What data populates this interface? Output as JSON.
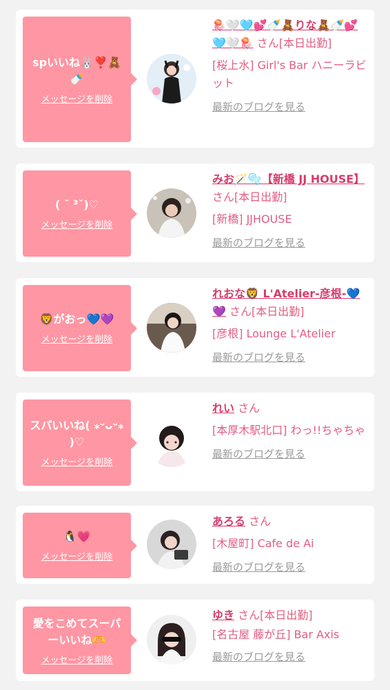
{
  "delete_label": "メッセージを削除",
  "blog_label": "最新のブログを見る",
  "honorific": "さん",
  "colors": {
    "bubble": "#ff96a3",
    "name": "#d63c6a",
    "accent": "#e35d83",
    "muted": "#9a9a9a"
  },
  "cards": [
    {
      "message": "spいいね🐰❣️🧸🍼",
      "name": "🪼🤍🩵💕🍼🧸りな🧸🍼💕🩵🤍🪼",
      "status": "[本日出勤]",
      "shop": "[桜上水] Girl's Bar ハニーラビット"
    },
    {
      "message": "( ˘ ³˘)♡",
      "name": "みお🪄🫧【新橋 JJ HOUSE】",
      "status": "[本日出勤]",
      "shop": "[新橋] JJHOUSE"
    },
    {
      "message": "🦁がおっ💙💜",
      "name": "れおな🦁 L'Atelier-彦根-💙💜",
      "status": "[本日出勤]",
      "shop": "[彦根] Lounge L'Atelier"
    },
    {
      "message": "スパいいね( ⁎ᵕᴗᵕ⁎ )♡",
      "name": "れい",
      "status": "",
      "shop": "[本厚木駅北口] わっ!!ちゃちゃ"
    },
    {
      "message": "🐧💗",
      "name": "あろる",
      "status": "",
      "shop": "[木屋町] Cafe de Ai"
    },
    {
      "message": "愛をこめてスーパーいいね🫶",
      "name": "ゆき",
      "status": "[本日出勤]",
      "shop": "[名古屋 藤が丘] Bar Axis"
    }
  ]
}
